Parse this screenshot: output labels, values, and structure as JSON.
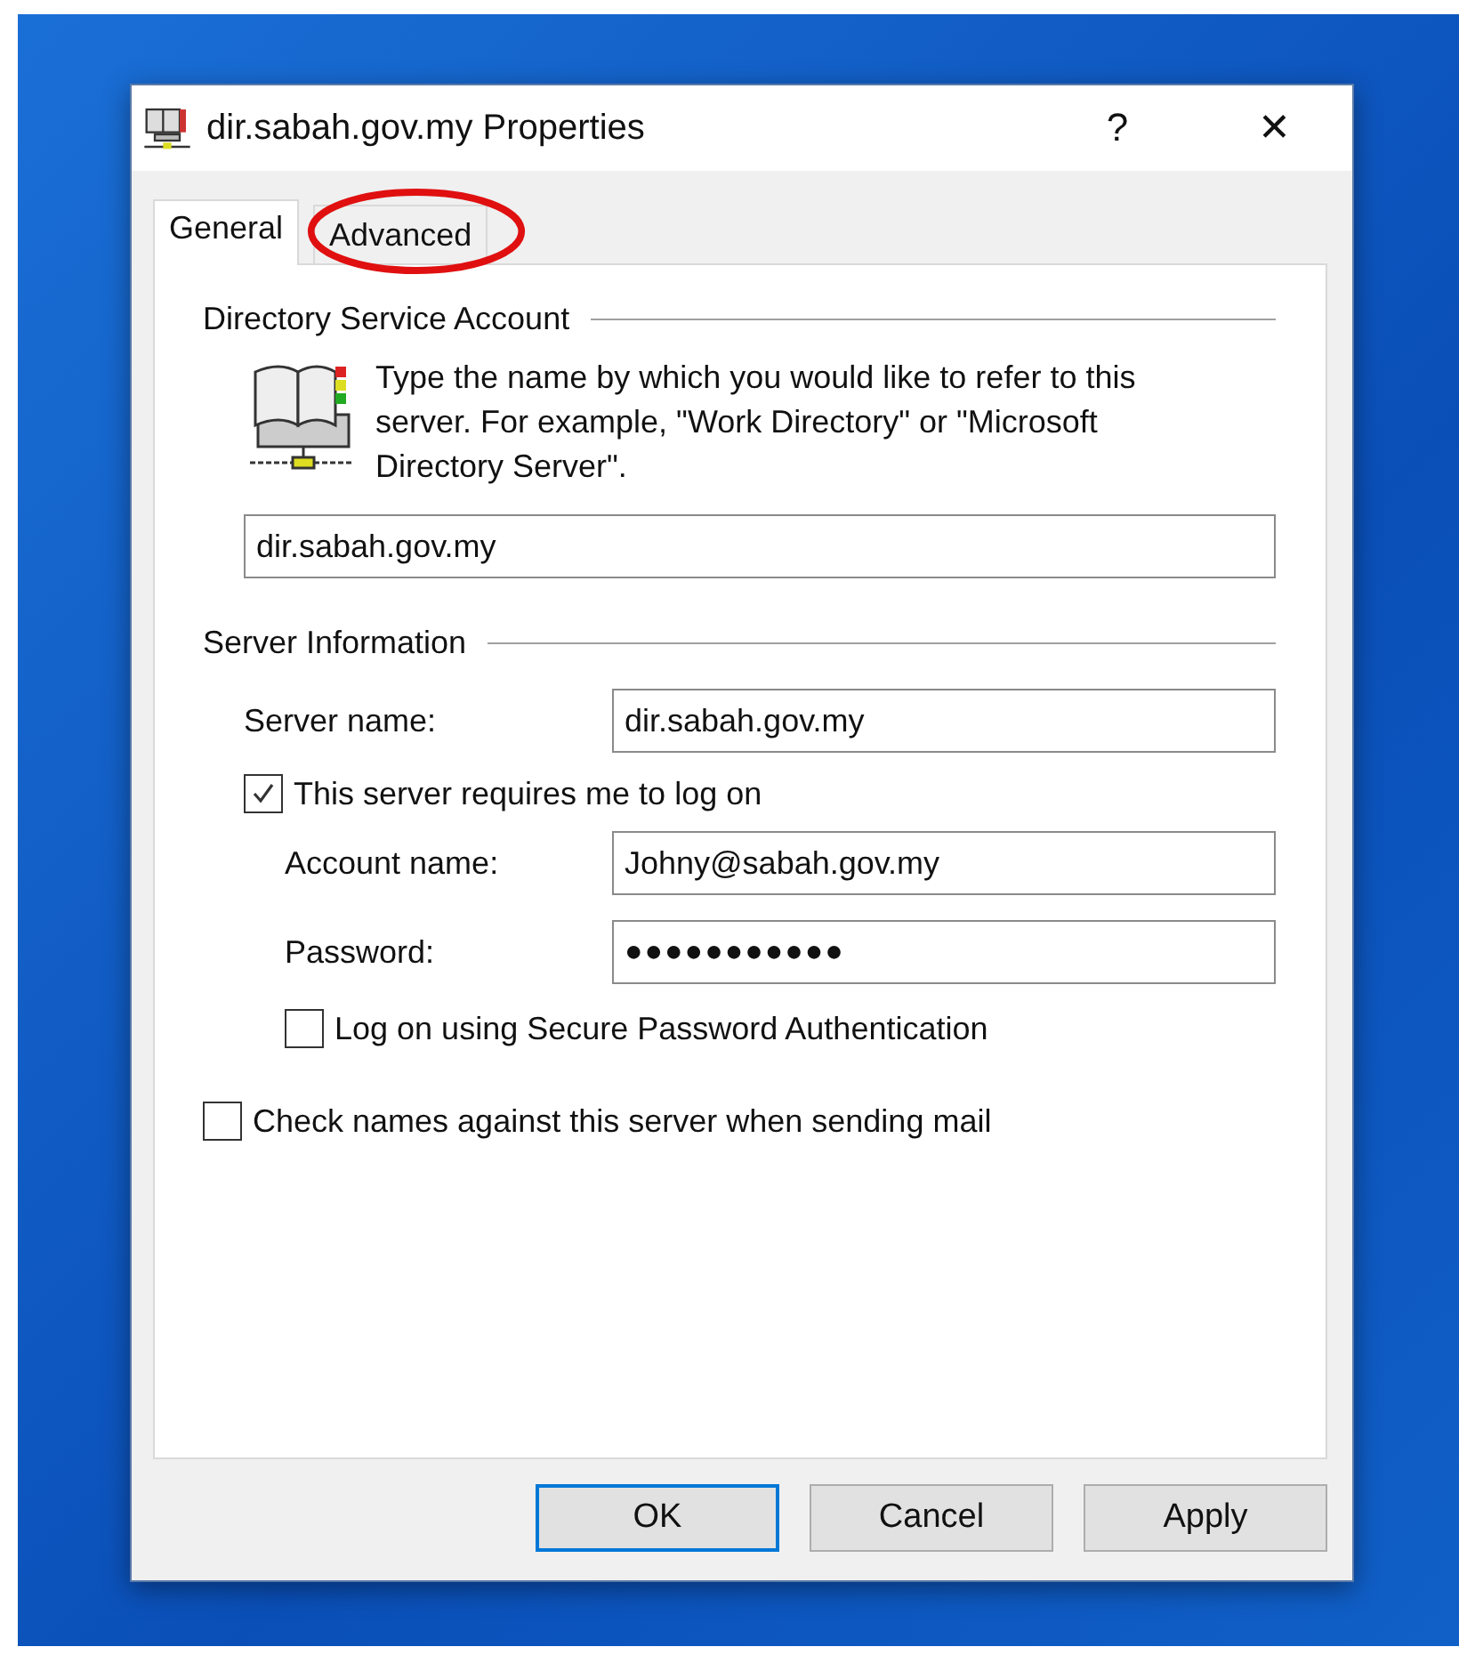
{
  "window": {
    "title": "dir.sabah.gov.my Properties",
    "help": "?",
    "close": "✕"
  },
  "tabs": [
    {
      "label": "General",
      "selected": true,
      "circled": false
    },
    {
      "label": "Advanced",
      "selected": false,
      "circled": true
    }
  ],
  "account": {
    "heading": "Directory Service Account",
    "description": "Type the name by which you would like to refer to this server. For example, \"Work Directory\" or \"Microsoft Directory Server\".",
    "value": "dir.sabah.gov.my"
  },
  "server": {
    "heading": "Server Information",
    "server_name": {
      "label": "Server name:",
      "value": "dir.sabah.gov.my"
    },
    "requires_logon": {
      "label": "This server requires me to log on",
      "checked": true
    },
    "account_name": {
      "label": "Account name:",
      "value": "Johny@sabah.gov.my"
    },
    "password": {
      "label": "Password:",
      "value": "●●●●●●●●●●●"
    },
    "spa": {
      "label": "Log on using Secure Password Authentication",
      "checked": false
    }
  },
  "check_names": {
    "label": "Check names against this server when sending mail",
    "checked": false
  },
  "buttons": [
    {
      "label": "OK",
      "default": true
    },
    {
      "label": "Cancel",
      "default": false
    },
    {
      "label": "Apply",
      "default": false
    }
  ]
}
